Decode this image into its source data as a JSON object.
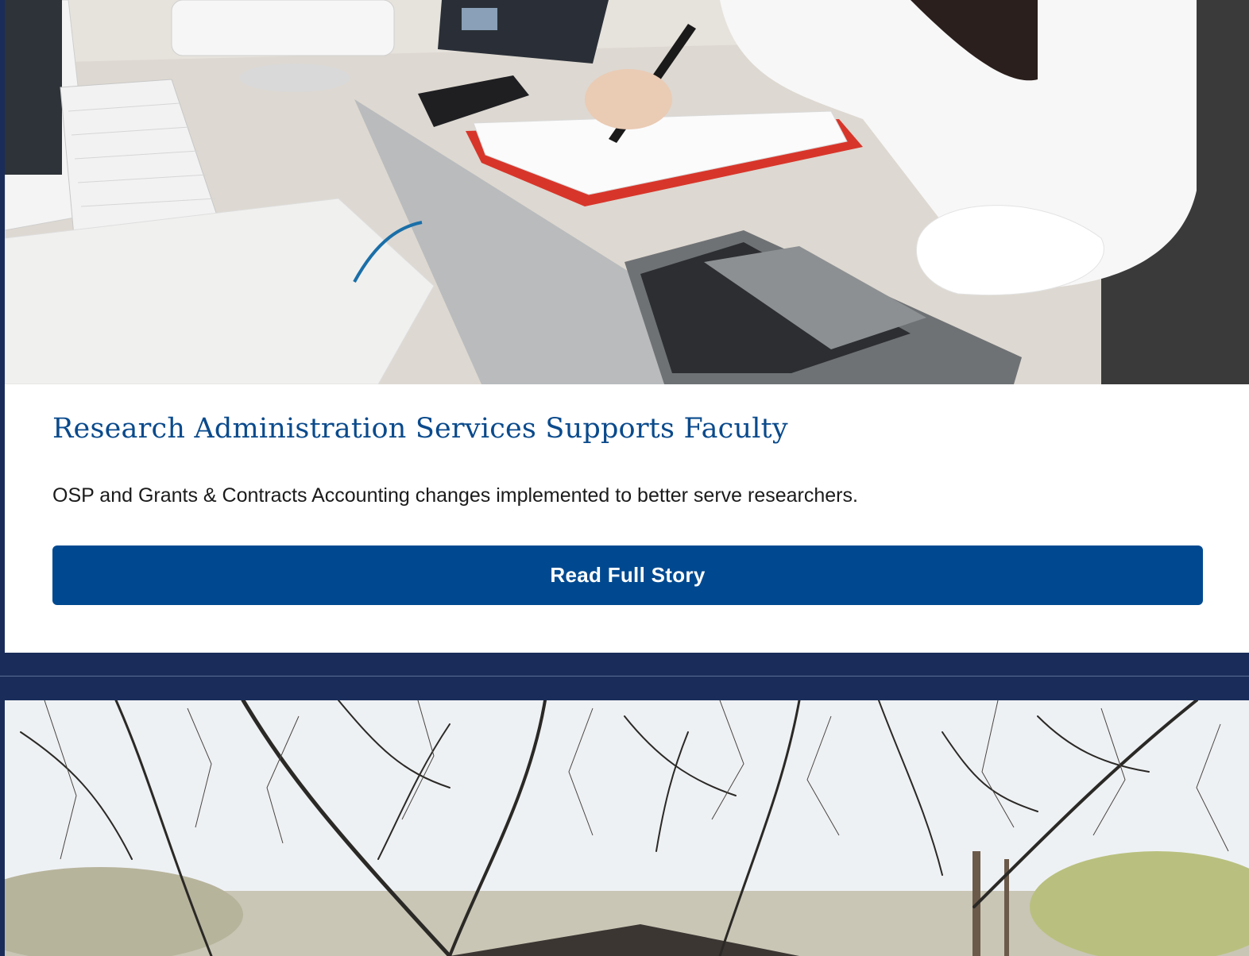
{
  "stories": [
    {
      "image_alt": "Woman writing in a notebook at a desk with a laptop",
      "title": "Research Administration Services Supports Faculty",
      "summary": "OSP and Grants & Contracts Accounting changes implemented to better serve researchers.",
      "button_label": "Read Full Story"
    },
    {
      "image_alt": "Bare trees over a building roof"
    }
  ],
  "colors": {
    "page_background": "#1a2d5a",
    "title": "#0a4a8c",
    "button": "#004990",
    "button_text": "#ffffff",
    "body_text": "#1b1b1b"
  }
}
